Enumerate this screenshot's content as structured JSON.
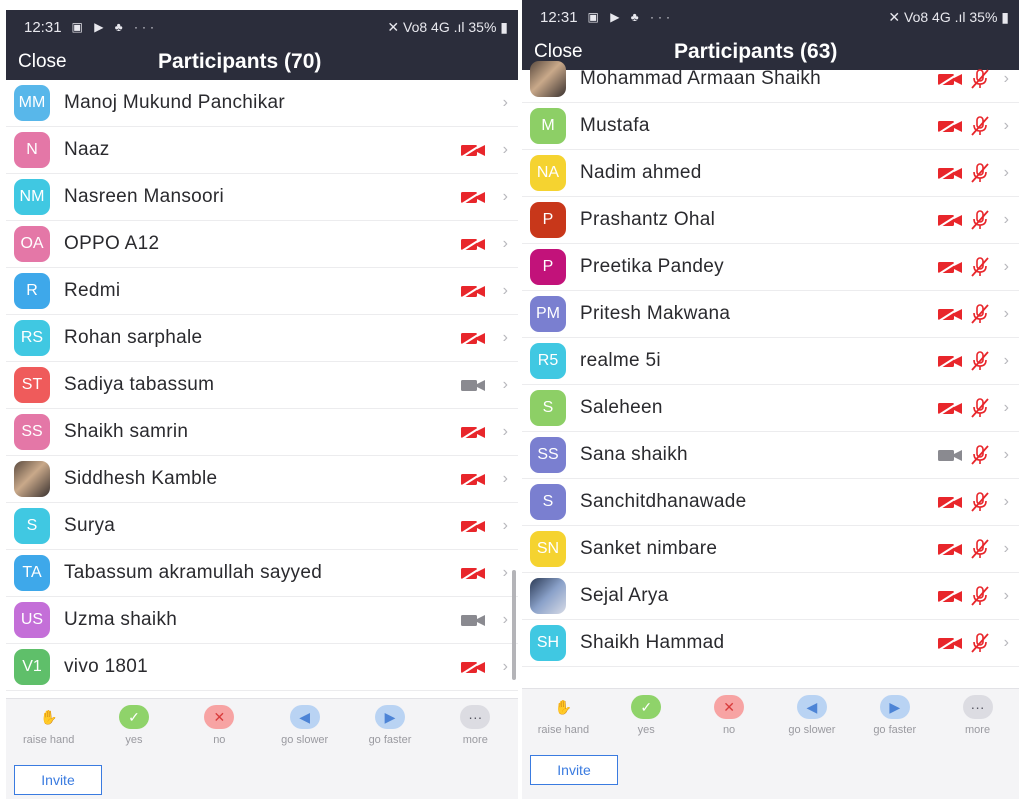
{
  "left": {
    "status": {
      "time": "12:31",
      "icons": "▣ ▶ ♣ ···",
      "right": "✕ Vo8 4G .ıl 35% ▮"
    },
    "nav": {
      "close": "Close",
      "title": "Participants (70)"
    },
    "participants": [
      {
        "initials": "MM",
        "name": "Manoj Mukund Panchikar",
        "color": "#58b7ea",
        "cam": "none"
      },
      {
        "initials": "N",
        "name": "Naaz",
        "color": "#e477a7",
        "cam": "off"
      },
      {
        "initials": "NM",
        "name": "Nasreen Mansoori",
        "color": "#40c8e2",
        "cam": "off"
      },
      {
        "initials": "OA",
        "name": "OPPO A12",
        "color": "#e477a7",
        "cam": "off"
      },
      {
        "initials": "R",
        "name": "Redmi",
        "color": "#3ea8ea",
        "cam": "off"
      },
      {
        "initials": "RS",
        "name": "Rohan sarphale",
        "color": "#40c8e2",
        "cam": "off"
      },
      {
        "initials": "ST",
        "name": "Sadiya tabassum",
        "color": "#ef5b5b",
        "cam": "on"
      },
      {
        "initials": "SS",
        "name": "Shaikh samrin",
        "color": "#e477a7",
        "cam": "off"
      },
      {
        "initials": "",
        "name": "Siddhesh Kamble",
        "color": "photo",
        "cam": "off"
      },
      {
        "initials": "S",
        "name": "Surya",
        "color": "#40c8e2",
        "cam": "off"
      },
      {
        "initials": "TA",
        "name": "Tabassum akramullah sayyed",
        "color": "#3ea8ea",
        "cam": "off"
      },
      {
        "initials": "US",
        "name": "Uzma shaikh",
        "color": "#c46fd8",
        "cam": "on"
      },
      {
        "initials": "V1",
        "name": "vivo 1801",
        "color": "#5fbf6a",
        "cam": "off"
      }
    ]
  },
  "right": {
    "status": {
      "time": "12:31",
      "icons": "▣ ▶ ♣ ···",
      "right": "✕ Vo8 4G .ıl 35% ▮"
    },
    "nav": {
      "close": "Close",
      "title": "Participants (63)"
    },
    "participants": [
      {
        "initials": "",
        "name": "Mohammad Armaan Shaikh",
        "color": "photo",
        "cam": "off"
      },
      {
        "initials": "M",
        "name": "Mustafa",
        "color": "#8dcf66",
        "cam": "off"
      },
      {
        "initials": "NA",
        "name": "Nadim ahmed",
        "color": "#f5d330",
        "cam": "off"
      },
      {
        "initials": "P",
        "name": "Prashantz Ohal",
        "color": "#c8371a",
        "cam": "off"
      },
      {
        "initials": "P",
        "name": "Preetika Pandey",
        "color": "#c2127a",
        "cam": "off"
      },
      {
        "initials": "PM",
        "name": "Pritesh Makwana",
        "color": "#7a7fd0",
        "cam": "off"
      },
      {
        "initials": "R5",
        "name": "realme 5i",
        "color": "#40c8e2",
        "cam": "off"
      },
      {
        "initials": "S",
        "name": "Saleheen",
        "color": "#8dcf66",
        "cam": "off"
      },
      {
        "initials": "SS",
        "name": "Sana shaikh",
        "color": "#7a7fd0",
        "cam": "on"
      },
      {
        "initials": "S",
        "name": "Sanchitdhanawade",
        "color": "#7a7fd0",
        "cam": "off"
      },
      {
        "initials": "SN",
        "name": "Sanket nimbare",
        "color": "#f5d330",
        "cam": "off"
      },
      {
        "initials": "",
        "name": "Sejal Arya",
        "color": "photo2",
        "cam": "off"
      },
      {
        "initials": "SH",
        "name": "Shaikh Hammad",
        "color": "#40c8e2",
        "cam": "off"
      }
    ]
  },
  "reactions": [
    {
      "label": "raise hand",
      "glyph": "✋",
      "bg": "#f4f4f6",
      "fg": "#f0a64a"
    },
    {
      "label": "yes",
      "glyph": "✓",
      "bg": "#8fd36a",
      "fg": "#ffffff"
    },
    {
      "label": "no",
      "glyph": "✕",
      "bg": "#f7a3a3",
      "fg": "#d83b3b"
    },
    {
      "label": "go slower",
      "glyph": "◀",
      "bg": "#b9d3f3",
      "fg": "#4d84d6"
    },
    {
      "label": "go faster",
      "glyph": "▶",
      "bg": "#b9d3f3",
      "fg": "#4d84d6"
    },
    {
      "label": "more",
      "glyph": "···",
      "bg": "#dcdce2",
      "fg": "#555560"
    }
  ],
  "invite_label": "Invite",
  "colors": {
    "header": "#2b2d3b",
    "cam_off": "#e8262b",
    "cam_on": "#8a8a90",
    "mic_off": "#e8262b"
  }
}
